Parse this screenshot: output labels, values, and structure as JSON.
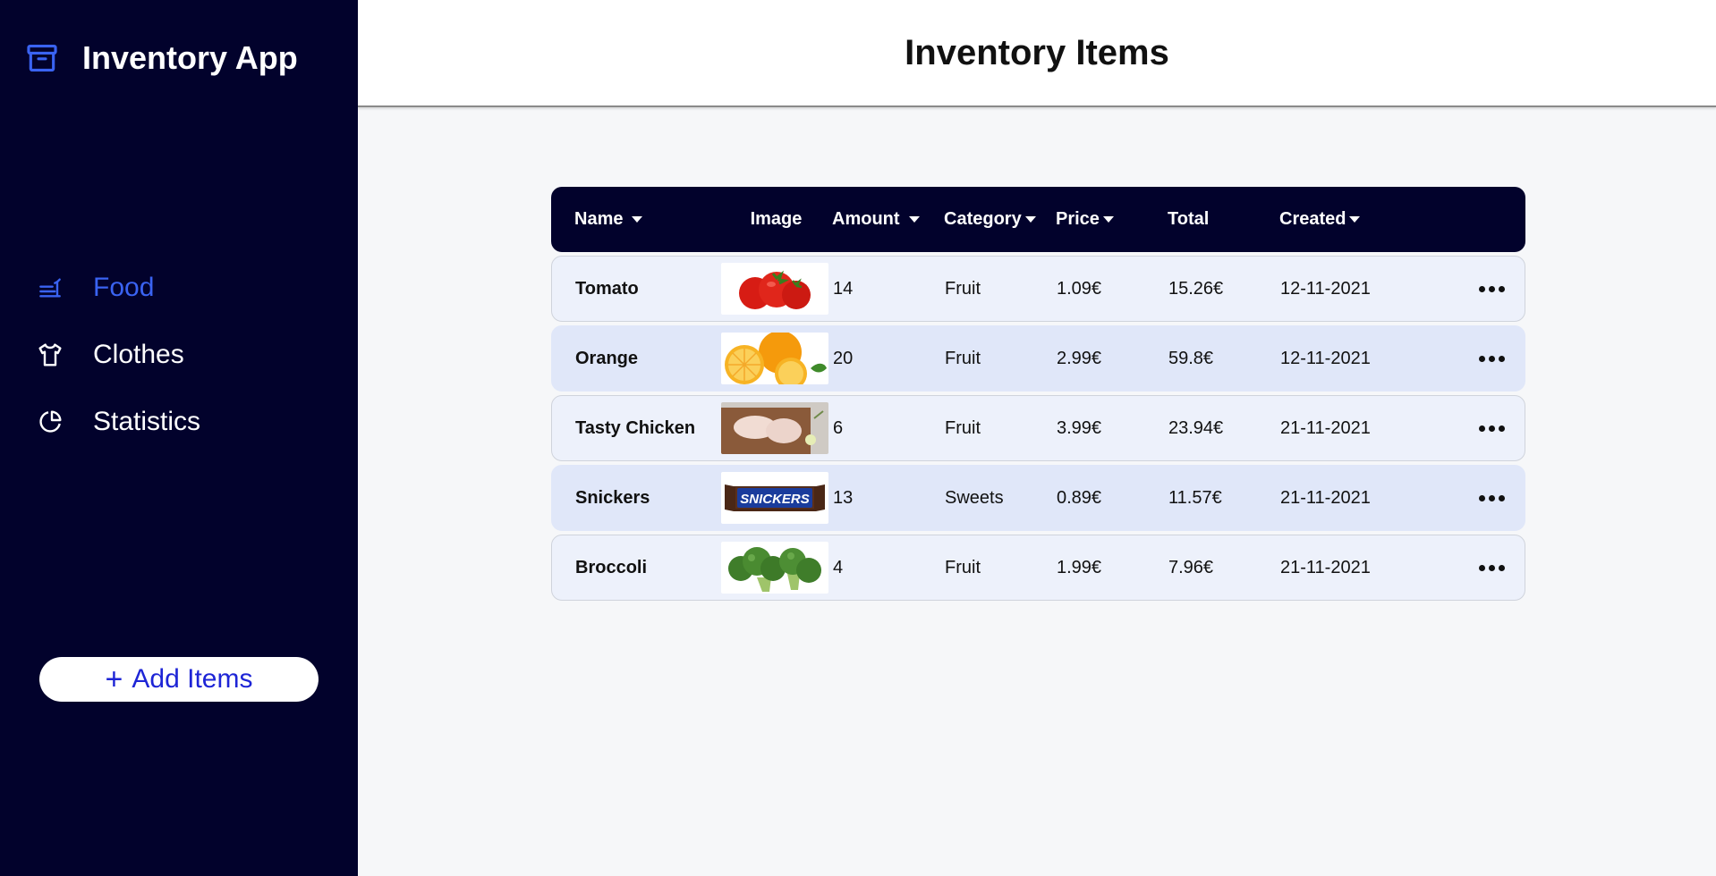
{
  "app": {
    "title": "Inventory App",
    "icon": "archive-icon",
    "accent": "#3a63f2",
    "sidebar_bg": "#02022c"
  },
  "sidebar": {
    "items": [
      {
        "label": "Food",
        "icon": "food-icon",
        "active": true
      },
      {
        "label": "Clothes",
        "icon": "shirt-icon",
        "active": false
      },
      {
        "label": "Statistics",
        "icon": "pie-chart-icon",
        "active": false
      }
    ],
    "add_button": {
      "plus": "+",
      "label": "Add Items"
    }
  },
  "header": {
    "title": "Inventory Items"
  },
  "table": {
    "columns": [
      {
        "label": "Name",
        "sortable": true
      },
      {
        "label": "Image",
        "sortable": false
      },
      {
        "label": "Amount",
        "sortable": true
      },
      {
        "label": "Category",
        "sortable": true
      },
      {
        "label": "Price",
        "sortable": true
      },
      {
        "label": "Total",
        "sortable": false
      },
      {
        "label": "Created",
        "sortable": true
      }
    ],
    "rows": [
      {
        "name": "Tomato",
        "image": "tomato-image",
        "amount": "14",
        "category": "Fruit",
        "price": "1.09€",
        "total": "15.26€",
        "created": "12-11-2021"
      },
      {
        "name": "Orange",
        "image": "orange-image",
        "amount": "20",
        "category": "Fruit",
        "price": "2.99€",
        "total": "59.8€",
        "created": "12-11-2021"
      },
      {
        "name": "Tasty Chicken",
        "image": "chicken-image",
        "amount": "6",
        "category": "Fruit",
        "price": "3.99€",
        "total": "23.94€",
        "created": "21-11-2021"
      },
      {
        "name": "Snickers",
        "image": "snickers-image",
        "amount": "13",
        "category": "Sweets",
        "price": "0.89€",
        "total": "11.57€",
        "created": "21-11-2021"
      },
      {
        "name": "Broccoli",
        "image": "broccoli-image",
        "amount": "4",
        "category": "Fruit",
        "price": "1.99€",
        "total": "7.96€",
        "created": "21-11-2021"
      }
    ],
    "row_action_icon": "more-horizontal-icon",
    "snickers_wrapper_text": "SNICKERS"
  }
}
